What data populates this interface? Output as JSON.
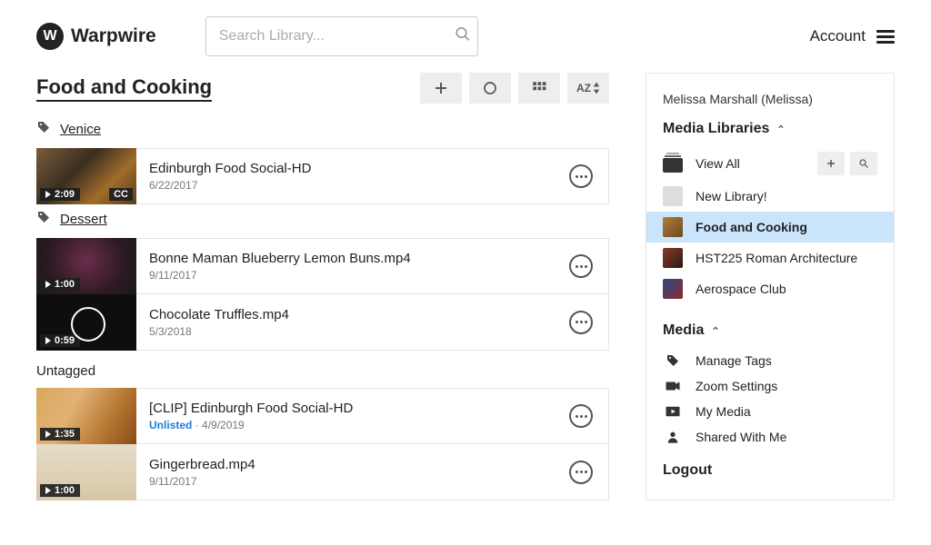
{
  "brand": {
    "name": "Warpwire",
    "mark": "W"
  },
  "search": {
    "placeholder": "Search Library..."
  },
  "header": {
    "account_label": "Account"
  },
  "library": {
    "title": "Food and Cooking",
    "sort_label": "AZ"
  },
  "groups": [
    {
      "tag": "Venice",
      "items": [
        {
          "title": "Edinburgh Food Social-HD",
          "date": "6/22/2017",
          "duration": "2:09",
          "cc": "CC",
          "thumb": "thumb-a"
        }
      ]
    },
    {
      "tag": "Dessert",
      "items": [
        {
          "title": "Bonne Maman Blueberry Lemon Buns.mp4",
          "date": "9/11/2017",
          "duration": "1:00",
          "thumb": "thumb-b"
        },
        {
          "title": "Chocolate Truffles.mp4",
          "date": "5/3/2018",
          "duration": "0:59",
          "thumb": "thumb-c"
        }
      ]
    },
    {
      "tag_plain": "Untagged",
      "items": [
        {
          "title": "[CLIP] Edinburgh Food Social-HD",
          "date": "4/9/2019",
          "duration": "1:35",
          "unlisted_label": "Unlisted",
          "thumb": "thumb-d"
        },
        {
          "title": "Gingerbread.mp4",
          "date": "9/11/2017",
          "duration": "1:00",
          "thumb": "thumb-e"
        }
      ]
    }
  ],
  "sidebar": {
    "user": "Melissa Marshall (Melissa)",
    "libraries_label": "Media Libraries",
    "view_all": "View All",
    "libraries": [
      {
        "name": "New Library!",
        "thumb": "blank"
      },
      {
        "name": "Food and Cooking",
        "thumb": "food",
        "active": true
      },
      {
        "name": "HST225 Roman Architecture",
        "thumb": "arch"
      },
      {
        "name": "Aerospace Club",
        "thumb": "aero"
      }
    ],
    "media_label": "Media",
    "media_items": [
      {
        "name": "Manage Tags",
        "icon": "tag"
      },
      {
        "name": "Zoom Settings",
        "icon": "camera"
      },
      {
        "name": "My Media",
        "icon": "play"
      },
      {
        "name": "Shared With Me",
        "icon": "person"
      }
    ],
    "logout_label": "Logout"
  }
}
